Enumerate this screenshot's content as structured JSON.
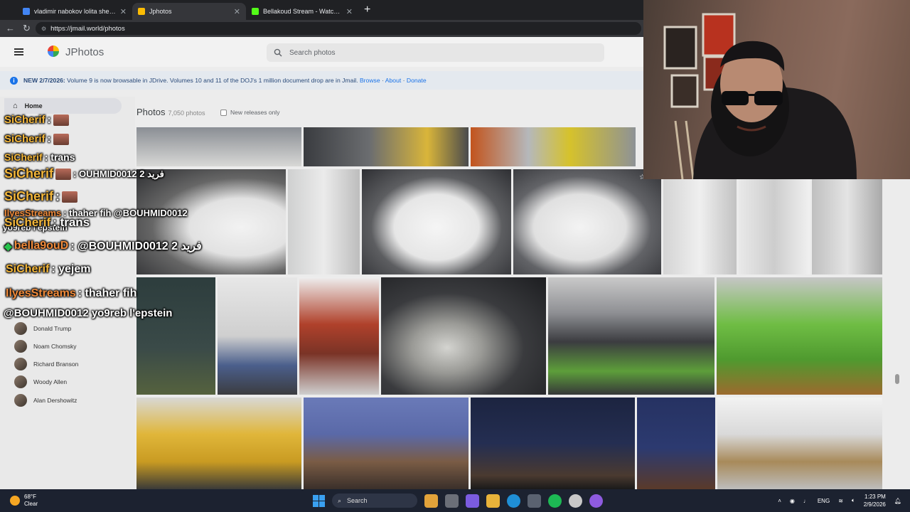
{
  "browser": {
    "tabs": [
      {
        "title": "vladimir nabokov lolita she was lo",
        "favicon_color": "#4285f4",
        "active": false
      },
      {
        "title": "Jphotos",
        "favicon_color": "#fbbc04",
        "active": true
      },
      {
        "title": "Bellakoud Stream - Watch Live on",
        "favicon_color": "#53fc18",
        "active": false
      }
    ],
    "url": "https://jmail.world/photos"
  },
  "app": {
    "name": "JPhotos",
    "search_placeholder": "Search photos",
    "banner": {
      "prefix": "NEW 2/7/2026:",
      "text": "Volume 9 is now browsable in JDrive. Volumes 10 and 11 of the DOJ's 1 million document drop are in Jmail.",
      "links": [
        "Browse",
        "About",
        "Donate"
      ]
    },
    "photos_title": "Photos",
    "photos_count": "7,050 photos",
    "new_releases_label": "New releases only"
  },
  "sidebar": {
    "home_label": "Home",
    "people": [
      "Donald Trump",
      "Noam Chomsky",
      "Richard Branson",
      "Woody Allen",
      "Alan Dershowitz"
    ]
  },
  "chat": [
    {
      "user": "SiCherif",
      "message": ":",
      "emote": true
    },
    {
      "user": "SiCherif",
      "message": ":",
      "emote": true
    },
    {
      "user": "SiCherif",
      "message": ": trans",
      "emote": false
    },
    {
      "user": "SiCherif",
      "message": ": OUHMID0012 2 فريد",
      "emote": true
    },
    {
      "user": "SiCherif",
      "message": ":",
      "emote": true
    },
    {
      "user": "IlyesStreams",
      "message": ": thaher fih @BOUHMID0012",
      "emote": false
    },
    {
      "user": "",
      "message": "yo9reb l'epstein",
      "emote": false
    },
    {
      "user": "SiCherif",
      "message": ": trans",
      "emote": false
    },
    {
      "user": "bella9ouD",
      "message": ": @BOUHMID0012 2 فريد",
      "emote": false
    },
    {
      "user": "SiCherif",
      "message": ": yejem",
      "emote": false
    },
    {
      "user": "IlyesStreams",
      "message": ": thaher fih",
      "emote": false
    },
    {
      "user": "",
      "message": "@BOUHMID0012 yo9reb l'epstein",
      "emote": false
    }
  ],
  "taskbar": {
    "weather_temp": "68°F",
    "weather_desc": "Clear",
    "search_label": "Search",
    "lang": "ENG",
    "time": "1:23 PM",
    "date": "2/9/2026"
  },
  "colors": {
    "accent": "#1a73e8",
    "chat_user": "#f4b73a",
    "taskbar": "#1c2230"
  }
}
